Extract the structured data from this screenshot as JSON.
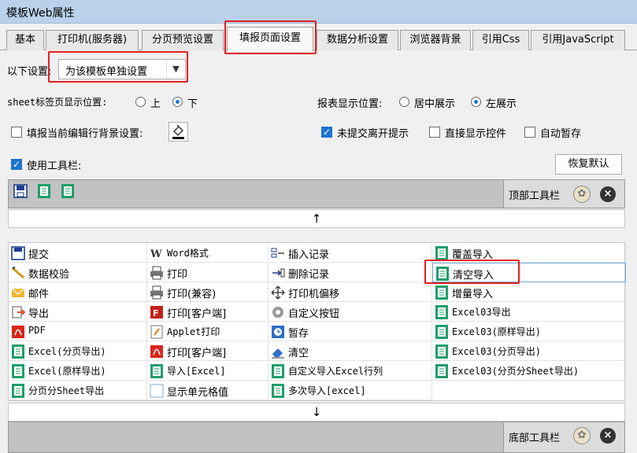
{
  "window": {
    "title": "模板Web属性"
  },
  "tabs": [
    "基本",
    "打印机(服务器)",
    "分页预览设置",
    "填报页面设置",
    "数据分析设置",
    "浏览器背景",
    "引用Css",
    "引用JavaScript"
  ],
  "settings": {
    "scope_label": "以下设置:",
    "scope_value": "为该模板单独设置",
    "sheet_pos_label": "sheet标签页显示位置:",
    "sheet_pos_options": [
      "上",
      "下"
    ],
    "sheet_pos_selected": "下",
    "report_pos_label": "报表显示位置:",
    "report_pos_options": [
      "居中展示",
      "左展示"
    ],
    "report_pos_selected": "左展示",
    "row_bg_label": "填报当前编辑行背景设置:",
    "row_bg_checked": false,
    "unsubmit_label": "未提交离开提示",
    "unsubmit_checked": true,
    "direct_label": "直接显示控件",
    "direct_checked": false,
    "autosave_label": "自动暂存",
    "autosave_checked": false,
    "use_toolbar_label": "使用工具栏:",
    "use_toolbar_checked": true,
    "restore_label": "恢复默认"
  },
  "top_toolbar": {
    "label": "顶部工具栏",
    "buttons": [
      "save-icon",
      "excel-icon",
      "excel-icon"
    ]
  },
  "bottom_toolbar": {
    "label": "底部工具栏"
  },
  "arrows": {
    "up": "↑",
    "down": "↓"
  },
  "items": [
    [
      {
        "label": "提交",
        "icon": "submit-icon"
      },
      {
        "label": "数据校验",
        "icon": "validate-icon"
      },
      {
        "label": "邮件",
        "icon": "mail-icon"
      },
      {
        "label": "导出",
        "icon": "export-icon"
      },
      {
        "label": "PDF",
        "icon": "pdf-icon"
      },
      {
        "label": "Excel(分页导出)",
        "icon": "excel-icon"
      },
      {
        "label": "Excel(原样导出)",
        "icon": "excel-icon"
      },
      {
        "label": "分页分Sheet导出",
        "icon": "excel-icon"
      }
    ],
    [
      {
        "label": "Word格式",
        "icon": "word-icon"
      },
      {
        "label": "打印",
        "icon": "print-icon"
      },
      {
        "label": "打印(兼容)",
        "icon": "print-icon"
      },
      {
        "label": "打印[客户端]",
        "icon": "flash-print-icon"
      },
      {
        "label": "Applet打印",
        "icon": "applet-icon"
      },
      {
        "label": "打印[客户端]",
        "icon": "pdf-print-icon"
      },
      {
        "label": "导入[Excel]",
        "icon": "excel-icon"
      },
      {
        "label": "显示单元格值",
        "icon": "blank-icon"
      }
    ],
    [
      {
        "label": "插入记录",
        "icon": "insert-row-icon"
      },
      {
        "label": "删除记录",
        "icon": "delete-row-icon"
      },
      {
        "label": "打印机偏移",
        "icon": "move-icon"
      },
      {
        "label": "自定义按钮",
        "icon": "gear-icon"
      },
      {
        "label": "暂存",
        "icon": "clock-icon"
      },
      {
        "label": "清空",
        "icon": "eraser-icon"
      },
      {
        "label": "自定义导入Excel行列",
        "icon": "excel-icon"
      },
      {
        "label": "多次导入[excel]",
        "icon": "excel-icon"
      }
    ],
    [
      {
        "label": "覆盖导入",
        "icon": "excel-icon"
      },
      {
        "label": "清空导入",
        "icon": "excel-icon"
      },
      {
        "label": "增量导入",
        "icon": "excel-icon"
      },
      {
        "label": "Excel03导出",
        "icon": "excel-icon"
      },
      {
        "label": "Excel03(原样导出)",
        "icon": "excel-icon"
      },
      {
        "label": "Excel03(分页导出)",
        "icon": "excel-icon"
      },
      {
        "label": "Excel03(分页分Sheet导出)",
        "icon": "excel-icon"
      }
    ]
  ]
}
